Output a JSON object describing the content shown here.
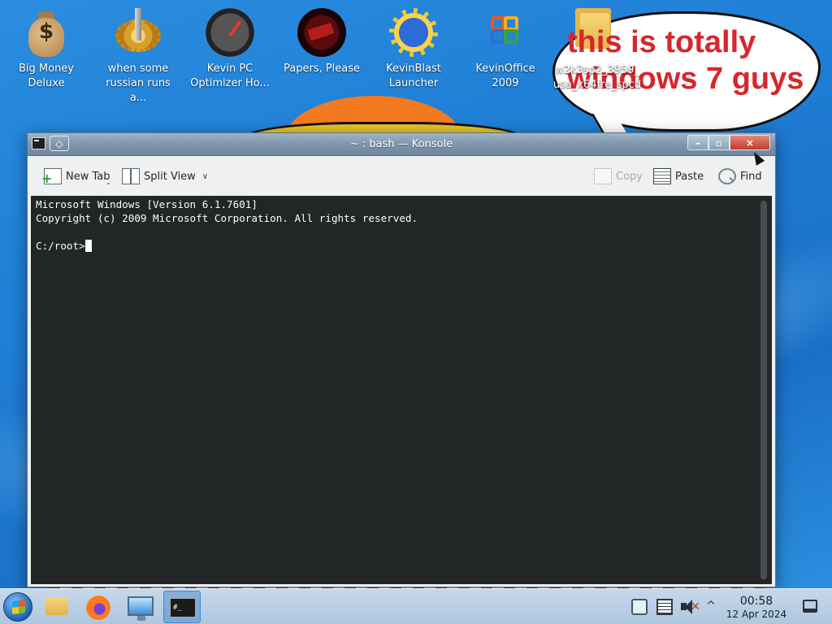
{
  "desktop": {
    "icons": [
      {
        "label": "Big Money\nDeluxe",
        "icon": "money-bag-icon"
      },
      {
        "label": "when some\nrussian runs a...",
        "icon": "gear-icon"
      },
      {
        "label": "Kevin PC\nOptimizer Ho...",
        "icon": "gauge-icon"
      },
      {
        "label": "Papers, Please",
        "icon": "papers-please-icon"
      },
      {
        "label": "KevinBlast\nLauncher",
        "icon": "kevinblast-icon"
      },
      {
        "label": "KevinOffice\n2009",
        "icon": "office-icon"
      },
      {
        "label": "w2k3sp2_3959_\nusa_x64fre_spcd",
        "icon": "folder-icon"
      }
    ],
    "meme_text": "this is totally\nwindows 7 guys"
  },
  "window": {
    "title": "~ : bash — Konsole",
    "buttons": {
      "minimize": "–",
      "maximize": "▫",
      "close": "×"
    },
    "toolbar": {
      "new_tab": "New Tab",
      "split_view": "Split View",
      "copy": "Copy",
      "paste": "Paste",
      "find": "Find"
    },
    "terminal": {
      "lines": [
        "Microsoft Windows [Version 6.1.7601]",
        "Copyright (c) 2009 Microsoft Corporation. All rights reserved.",
        "",
        "C:/root>"
      ]
    }
  },
  "taskbar": {
    "apps": [
      {
        "name": "file-manager-icon"
      },
      {
        "name": "firefox-icon"
      },
      {
        "name": "system-settings-icon"
      },
      {
        "name": "konsole-icon",
        "active": true,
        "label": "#_"
      }
    ],
    "tray": {
      "mute_mark": "✕",
      "expand": "^"
    },
    "clock": {
      "time": "00:58",
      "date": "12 Apr 2024"
    }
  },
  "colors": {
    "titlebar": "#7e95ab",
    "terminal_bg": "#232627",
    "terminal_fg": "#fcfcfc",
    "meme_red": "#d7262d"
  }
}
